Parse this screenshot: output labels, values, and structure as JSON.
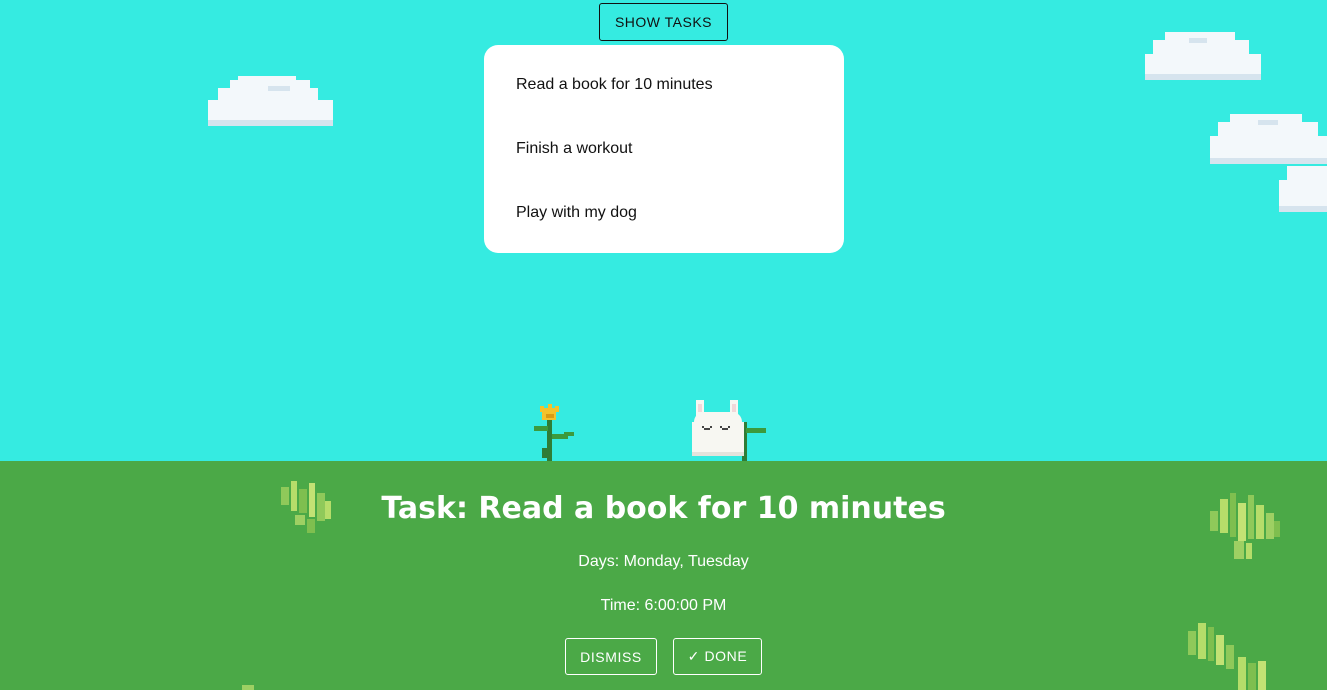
{
  "header": {
    "show_tasks_label": "SHOW TASKS"
  },
  "tasks": [
    {
      "label": "Read a book for 10 minutes"
    },
    {
      "label": "Finish a workout"
    },
    {
      "label": "Play with my dog"
    }
  ],
  "current_task": {
    "title": "Task: Read a book for 10 minutes",
    "days": "Days: Monday, Tuesday",
    "time": "Time: 6:00:00 PM"
  },
  "actions": {
    "dismiss_label": "DISMISS",
    "done_label": "✓ DONE"
  },
  "colors": {
    "sky": "#35ebe1",
    "ground": "#4ba947",
    "panel": "#ffffff"
  },
  "icons": [
    "cloud-icon",
    "flower-icon",
    "bunny-icon",
    "bush-icon"
  ]
}
